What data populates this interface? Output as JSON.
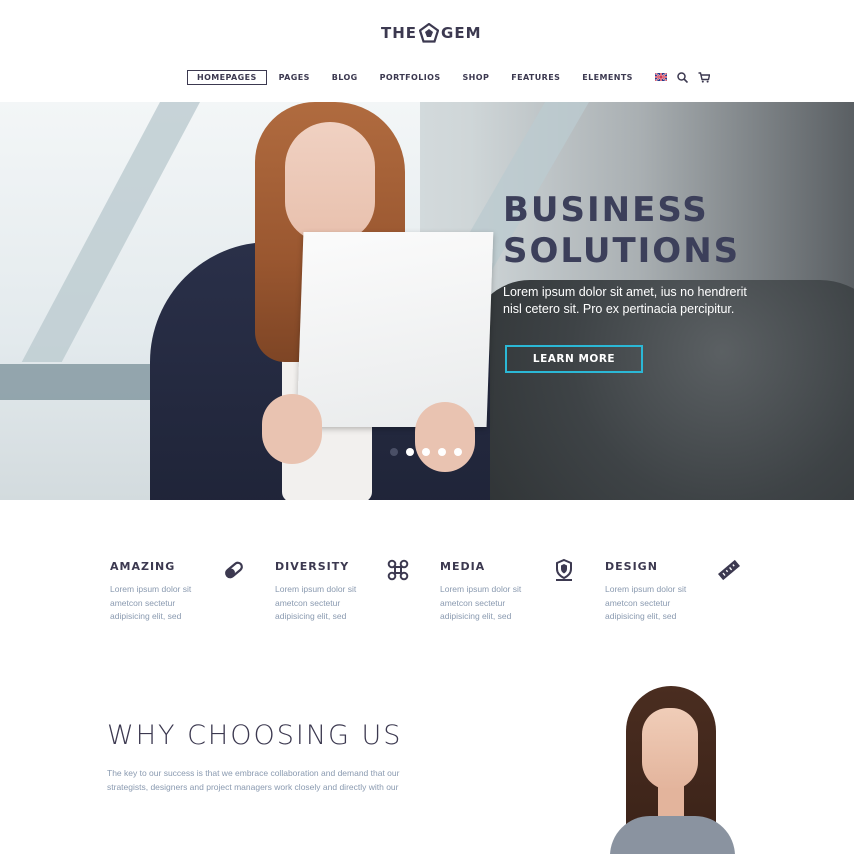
{
  "brand": {
    "logo_left": "THE",
    "logo_right": "GEM"
  },
  "nav": {
    "items": [
      "HOMEPAGES",
      "PAGES",
      "BLOG",
      "PORTFOLIOS",
      "SHOP",
      "FEATURES",
      "ELEMENTS"
    ],
    "active": "HOMEPAGES",
    "icons": [
      "uk-flag-icon",
      "search-icon",
      "cart-icon"
    ]
  },
  "hero": {
    "title_line1": "BUSINESS",
    "title_line2": "SOLUTIONS",
    "description": "Lorem ipsum dolor sit amet, ius no hendrerit nisl cetero sit. Pro ex pertinacia percipitur.",
    "button_label": "LEARN MORE",
    "slides": 5,
    "active_slide": 1,
    "accent_color": "#2bb8d6"
  },
  "features": [
    {
      "title": "AMAZING",
      "text": "Lorem ipsum dolor sit ametcon sectetur adipisicing elit, sed",
      "icon": "pill-icon"
    },
    {
      "title": "DIVERSITY",
      "text": "Lorem ipsum dolor sit ametcon sectetur adipisicing elit, sed",
      "icon": "command-icon"
    },
    {
      "title": "MEDIA",
      "text": "Lorem ipsum dolor sit ametcon sectetur adipisicing elit, sed",
      "icon": "shield-pin-icon"
    },
    {
      "title": "DESIGN",
      "text": "Lorem ipsum dolor sit ametcon sectetur adipisicing elit, sed",
      "icon": "ruler-icon"
    }
  ],
  "why": {
    "title": "WHY CHOOSING US",
    "text": "The key to our success is that we embrace collaboration and demand that our strategists, designers and project managers work closely and directly with our"
  }
}
